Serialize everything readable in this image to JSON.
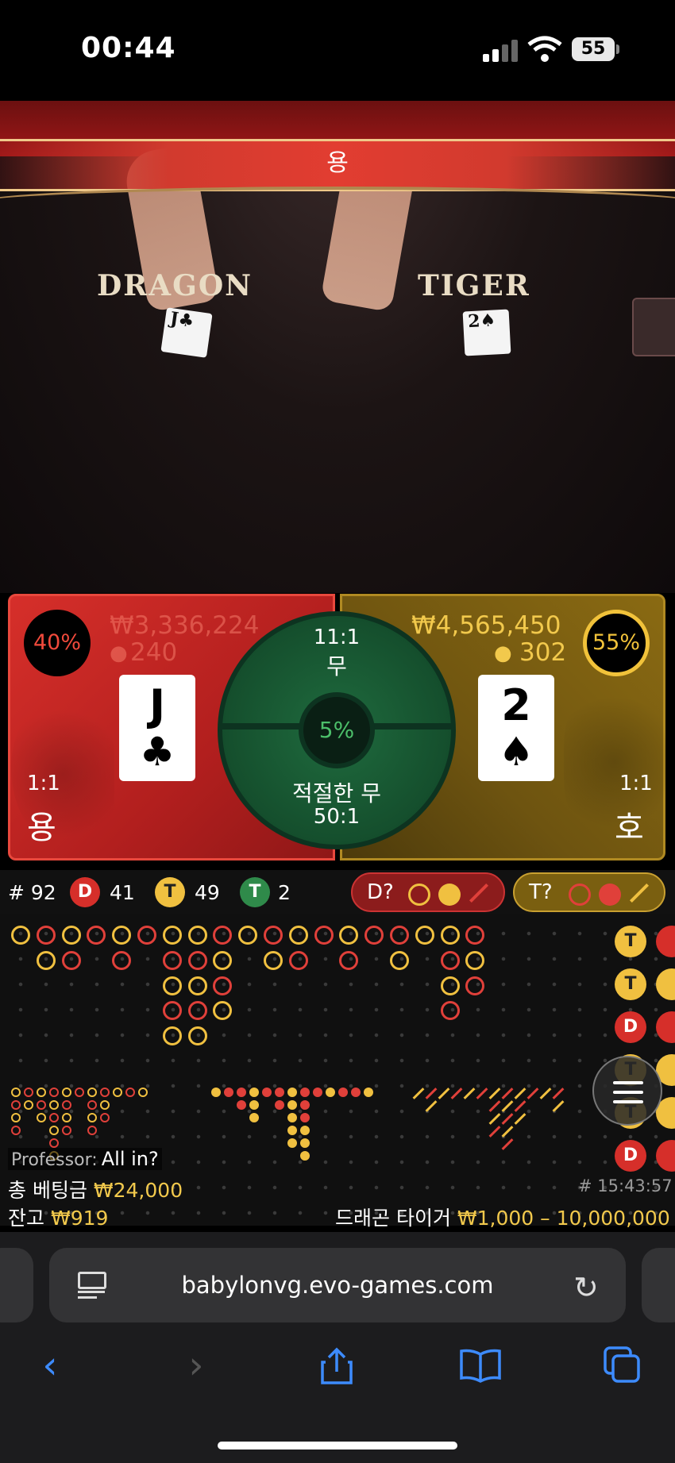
{
  "status_bar": {
    "time": "00:44",
    "battery": "55"
  },
  "game": {
    "banner": "용",
    "table_left_label": "DRAGON",
    "table_right_label": "TIGER",
    "table_card_left": "J♣",
    "table_card_right": "2♠"
  },
  "bets": {
    "dragon": {
      "percent": "40%",
      "amount": "₩3,336,224",
      "players": "240",
      "card_rank": "J",
      "card_suit": "♣",
      "odds": "1:1",
      "name": "용",
      "color": "#d62f2a"
    },
    "tiger": {
      "percent": "55%",
      "amount": "₩4,565,450",
      "players": "302",
      "card_rank": "2",
      "card_suit": "♠",
      "odds": "1:1",
      "name": "호",
      "color": "#8a6a12"
    },
    "tie": {
      "odds": "11:1",
      "name": "무",
      "percent": "5%",
      "suited_name": "적절한 무",
      "suited_odds": "50:1",
      "color": "#1f6b3e"
    }
  },
  "stats": {
    "round_label": "# 92",
    "dragon_badge": "D",
    "dragon_count": "41",
    "tiger_badge": "T",
    "tiger_count": "49",
    "tie_badge": "T",
    "tie_count": "2",
    "dragon_predict": "D?",
    "tiger_predict": "T?"
  },
  "roadmap": {
    "side_badges": [
      "T",
      "T",
      "D",
      "T",
      "T",
      "D"
    ]
  },
  "info": {
    "chat_user": "Professor:",
    "chat_message": "All in?",
    "total_bet_label": "총 베팅금",
    "total_bet_value": "₩24,000",
    "balance_label": "잔고",
    "balance_value": "₩919",
    "round_time": "# 15:43:57",
    "table_name": "드래곤 타이거",
    "limits": "₩1,000 – 10,000,000"
  },
  "browser": {
    "url": "babylonvg.evo-games.com"
  }
}
